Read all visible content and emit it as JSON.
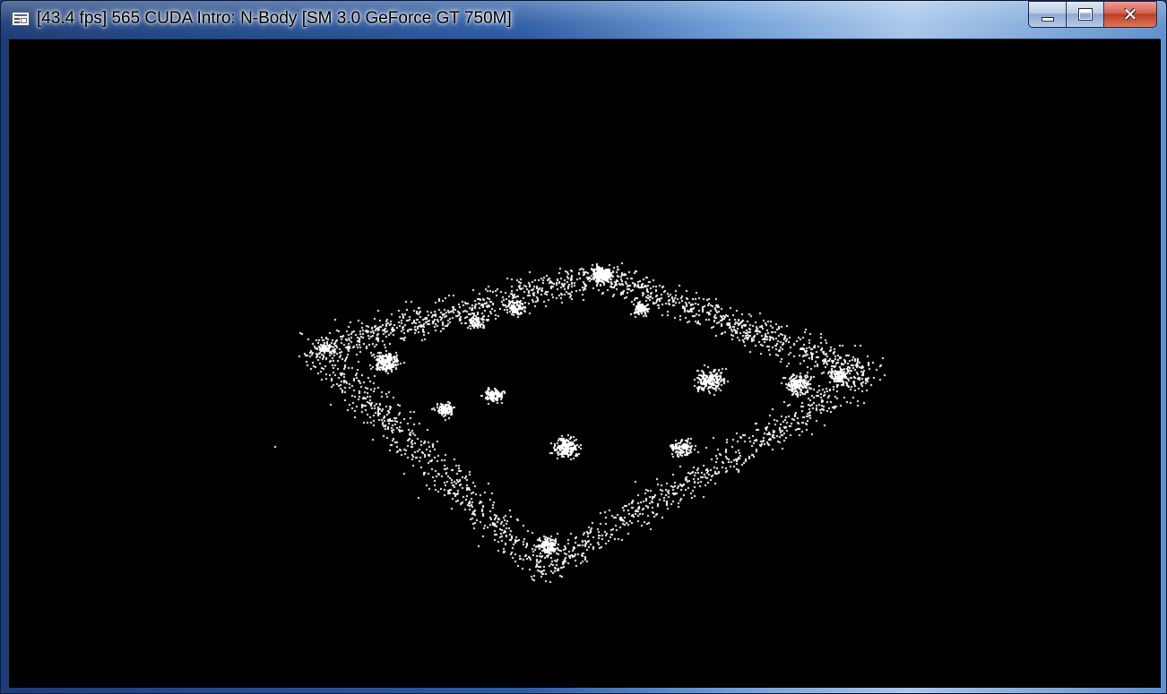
{
  "window": {
    "title": "[43.4 fps] 565 CUDA Intro: N-Body [SM 3.0 GeForce GT 750M]",
    "app_icon": "application-window-icon",
    "controls": {
      "minimize": {
        "icon": "minimize-icon",
        "glyph": ""
      },
      "maximize": {
        "icon": "maximize-icon",
        "glyph": ""
      },
      "close": {
        "icon": "close-icon",
        "glyph": "✕"
      }
    }
  },
  "viewport": {
    "background": "#000000",
    "particle_color": "#ffffff",
    "content": "N-body particle simulation rendered as white points on black"
  },
  "colors": {
    "frame_dark": "#1c3d78",
    "frame_light": "#a8c6ea",
    "close_red": "#c03a22"
  }
}
